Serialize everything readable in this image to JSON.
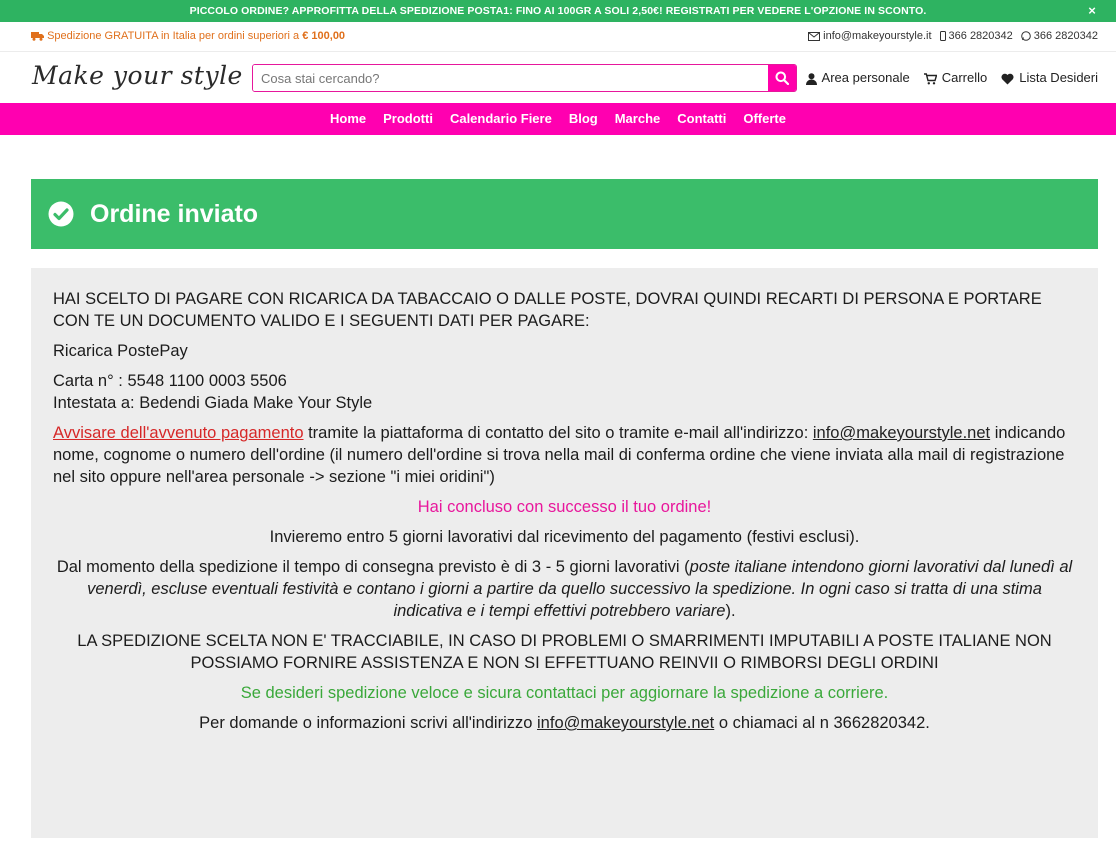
{
  "promo": {
    "text": "PICCOLO ORDINE? APPROFITTA DELLA SPEDIZIONE POSTA1: FINO AI 100GR A SOLI 2,50€! REGISTRATI PER VEDERE L'OPZIONE IN SCONTO.",
    "close": "×",
    "bg_color": "#2eb361"
  },
  "topbar": {
    "shipping_prefix": "Spedizione GRATUITA in Italia per ordini superiori a",
    "shipping_amount": "€ 100,00",
    "email": "info@makeyourstyle.it",
    "phone": "366 2820342",
    "whatsapp": "366 2820342"
  },
  "header": {
    "logo": "Make your style",
    "search_placeholder": "Cosa stai cercando?",
    "account": "Area personale",
    "cart": "Carrello",
    "wishlist": "Lista Desideri"
  },
  "nav": {
    "items": [
      "Home",
      "Prodotti",
      "Calendario Fiere",
      "Blog",
      "Marche",
      "Contatti",
      "Offerte"
    ],
    "bg_color": "#ff00b0"
  },
  "banner": {
    "title": "Ordine inviato",
    "bg_color": "#3bbd6a"
  },
  "content": {
    "intro": "HAI SCELTO DI PAGARE CON RICARICA DA TABACCAIO O DALLE POSTE, DOVRAI QUINDI RECARTI DI PERSONA E PORTARE CON TE UN DOCUMENTO VALIDO E I SEGUENTI DATI PER PAGARE:",
    "method": "Ricarica PostePay",
    "card_line": "Carta n° : 5548 1100 0003 5506",
    "holder_line": "Intestata a: Bedendi Giada Make Your Style",
    "notify_link": "Avvisare dell'avvenuto pagamento",
    "notify_text_1": " tramite la piattaforma di contatto del sito o tramite e-mail all'indirizzo: ",
    "notify_email": "info@makeyourstyle.net",
    "notify_text_2": " indicando nome, cognome o numero dell'ordine (il numero dell'ordine si trova nella mail di conferma ordine che viene inviata alla mail di registrazione nel sito oppure nell'area personale -> sezione \"i miei oridini\")",
    "success": "Hai concluso con successo il tuo ordine!",
    "shipping_time": "Invieremo entro 5 giorni lavorativi dal ricevimento del pagamento (festivi esclusi).",
    "delivery_1": "Dal momento della spedizione il tempo di consegna previsto è di 3 - 5 giorni lavorativi (",
    "delivery_italic": "poste italiane intendono giorni lavorativi dal lunedì al venerdì, escluse eventuali festività e contano i giorni a partire da quello successivo la spedizione. In ogni caso si tratta di una stima indicativa e i tempi effettivi potrebbero variare",
    "delivery_2": ").",
    "warning": "LA SPEDIZIONE SCELTA NON E' TRACCIABILE, IN CASO DI PROBLEMI O SMARRIMENTI IMPUTABILI A POSTE ITALIANE NON POSSIAMO FORNIRE ASSISTENZA E NON SI EFFETTUANO REINVII O RIMBORSI DEGLI ORDINI",
    "courier": "Se desideri spedizione veloce e sicura contattaci per aggiornare la spedizione a corriere.",
    "questions_1": "Per domande o informazioni scrivi all'indirizzo ",
    "questions_email": "info@makeyourstyle.net",
    "questions_2": " o chiamaci al n 3662820342."
  }
}
